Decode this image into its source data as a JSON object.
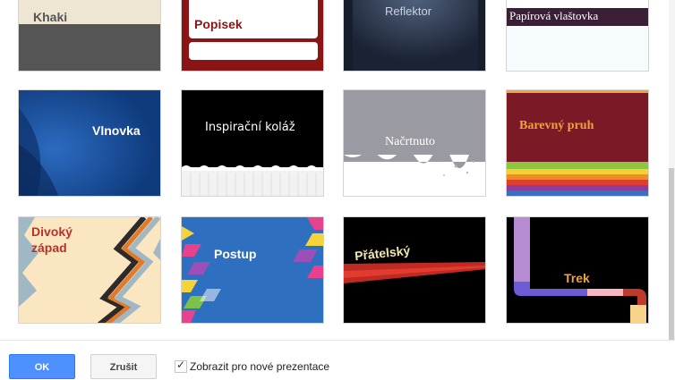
{
  "themes": [
    {
      "id": "khaki",
      "label": "Khaki"
    },
    {
      "id": "popisek",
      "label": "Popisek"
    },
    {
      "id": "reflektor",
      "label": "Reflektor"
    },
    {
      "id": "vlastovka",
      "label": "Papírová vlaštovka"
    },
    {
      "id": "vlnovka",
      "label": "Vlnovka"
    },
    {
      "id": "koláž",
      "label": "Inspirační koláž"
    },
    {
      "id": "nacrtnuto",
      "label": "Načrtnuto"
    },
    {
      "id": "barevny_pruh",
      "label": "Barevný pruh"
    },
    {
      "id": "divoky",
      "label": "Divoký\nzápad",
      "label_line1": "Divoký",
      "label_line2": "západ"
    },
    {
      "id": "postup",
      "label": "Postup"
    },
    {
      "id": "pratelsky",
      "label": "Přátelský"
    },
    {
      "id": "trek",
      "label": "Trek"
    }
  ],
  "footer": {
    "ok_label": "OK",
    "cancel_label": "Zrušit",
    "checkbox_label": "Zobrazit pro nové prezentace",
    "checkbox_checked": true
  },
  "colors": {
    "accent": "#4d90fe",
    "popisek_red": "#8b1414",
    "barevny_red": "#7b1a26",
    "vlnovka_blue": "#1d4f9c"
  }
}
